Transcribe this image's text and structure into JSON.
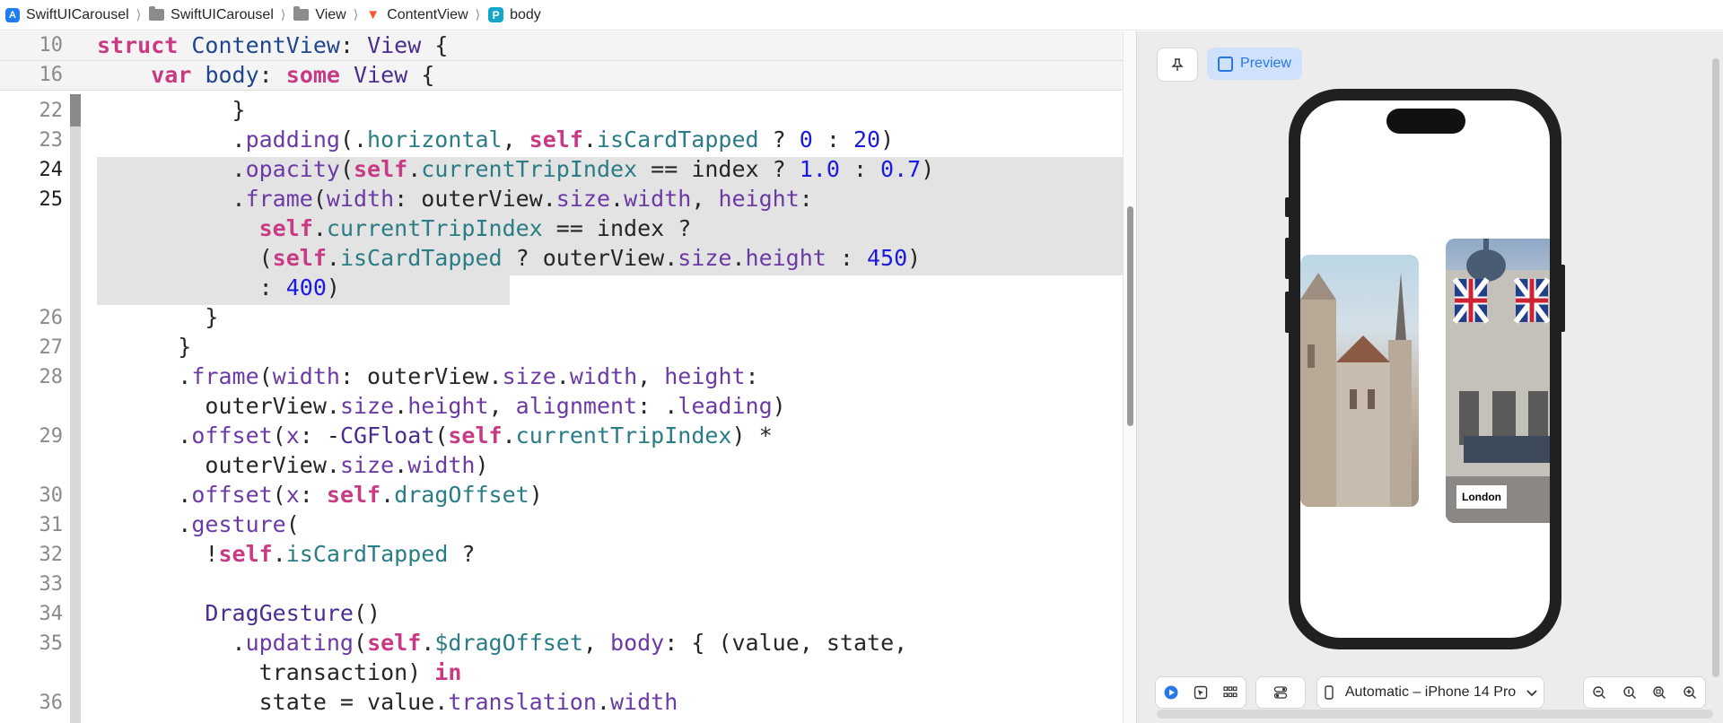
{
  "breadcrumb": {
    "items": [
      "SwiftUICarousel",
      "SwiftUICarousel",
      "View",
      "ContentView",
      "body"
    ],
    "separator": "⟩"
  },
  "editor": {
    "sticky_lines": [
      {
        "num": "10",
        "text": "struct ContentView: View {"
      },
      {
        "num": "16",
        "text": "    var body: some View {"
      }
    ],
    "line_numbers": [
      "22",
      "23",
      "24",
      "25",
      "26",
      "27",
      "28",
      "29",
      "30",
      "31",
      "32",
      "33",
      "34",
      "35",
      "36"
    ],
    "lines": [
      "}",
      ".padding(.horizontal, self.isCardTapped ? 0 : 20)",
      ".opacity(self.currentTripIndex == index ? 1.0 : 0.7)",
      ".frame(width: outerView.size.width, height:",
      "self.currentTripIndex == index ?",
      "(self.isCardTapped ? outerView.size.height : 450)",
      ": 400)",
      "}",
      "}",
      ".frame(width: outerView.size.width, height:",
      "outerView.size.height, alignment: .leading)",
      ".offset(x: -CGFloat(self.currentTripIndex) *",
      "outerView.size.width)",
      ".offset(x: self.dragOffset)",
      ".gesture(",
      "!self.isCardTapped ?",
      "",
      "DragGesture()",
      ".updating(self.$dragOffset, body: { (value, state,",
      "transaction) in",
      "state = value.translation.width"
    ]
  },
  "canvas": {
    "preview_label": "Preview",
    "card_label": "London",
    "device": "Automatic – iPhone 14 Pro"
  },
  "colors": {
    "keyword": "#c83b84",
    "number": "#1a1ae0",
    "member": "#2a7c85",
    "accent": "#2777e8"
  }
}
